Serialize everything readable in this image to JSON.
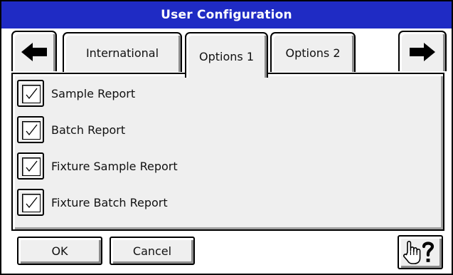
{
  "window": {
    "title": "User Configuration"
  },
  "nav": {
    "prev_icon": "arrow-left-icon",
    "next_icon": "arrow-right-icon"
  },
  "tabs": [
    {
      "label": "International",
      "active": false
    },
    {
      "label": "Options 1",
      "active": true
    },
    {
      "label": "Options 2",
      "active": false
    }
  ],
  "options": [
    {
      "label": "Sample Report",
      "checked": true
    },
    {
      "label": "Batch Report",
      "checked": true
    },
    {
      "label": "Fixture Sample Report",
      "checked": true
    },
    {
      "label": "Fixture Batch Report",
      "checked": true
    }
  ],
  "buttons": {
    "ok": "OK",
    "cancel": "Cancel",
    "help_icon": "hand-pointer-question-icon"
  },
  "colors": {
    "titlebar": "#1f2bc4",
    "face": "#efefef"
  }
}
